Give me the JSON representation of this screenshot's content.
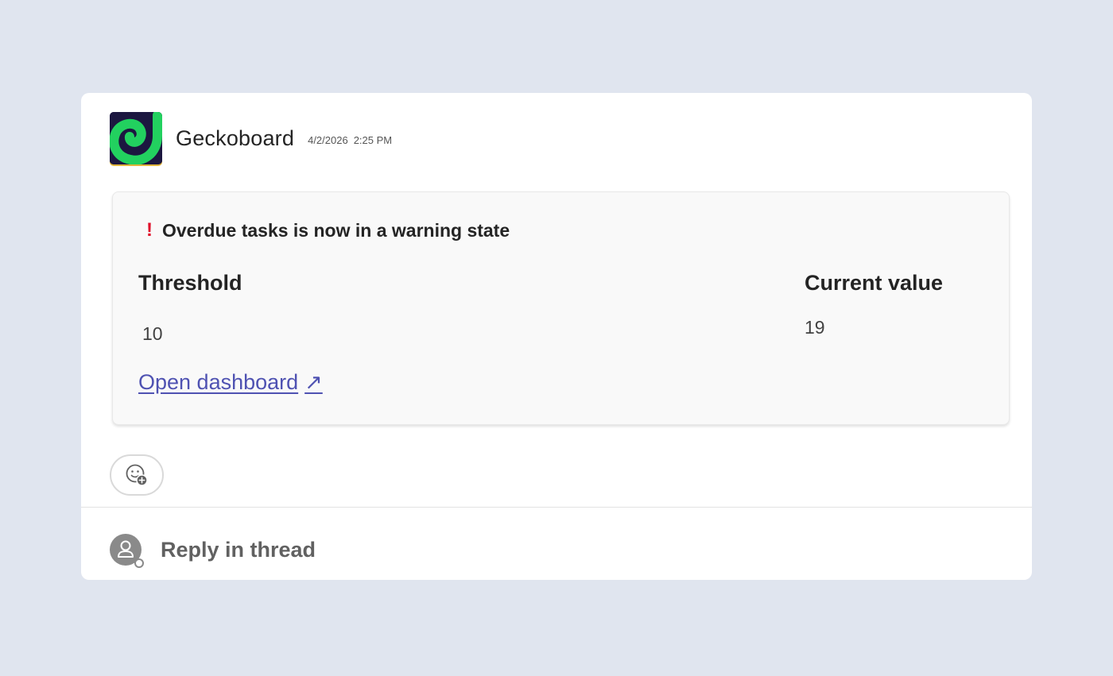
{
  "message": {
    "sender": "Geckoboard",
    "date": "4/2/2026",
    "time": "2:25 PM",
    "app_icon": "geckoboard-logo",
    "brand_colors": {
      "logo_bg": "#1c1740",
      "logo_fg": "#22d15f",
      "accent": "#4f52b2"
    }
  },
  "alert": {
    "icon": "exclamation-icon",
    "title": "Overdue tasks is now in a warning state",
    "threshold_label": "Threshold",
    "threshold_value": "10",
    "current_label": "Current value",
    "current_value": "19",
    "link_label": "Open dashboard",
    "link_icon": "↗"
  },
  "reactions": {
    "add_icon": "add-reaction-icon"
  },
  "reply": {
    "label": "Reply in thread",
    "avatar_icon": "user-avatar-icon"
  }
}
